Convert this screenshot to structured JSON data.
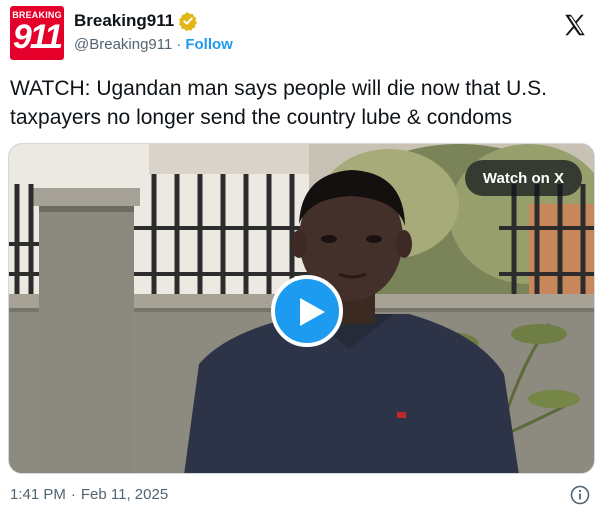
{
  "author": {
    "avatar_text_top": "BREAKING",
    "avatar_text_number": "911",
    "display_name": "Breaking911",
    "handle": "@Breaking911",
    "separator": "·",
    "follow_label": "Follow",
    "verified_icon": "verified-badge-icon",
    "brand_color": "#e4002b"
  },
  "platform_icon": "x-logo-icon",
  "tweet": {
    "line1": "WATCH: Ugandan man says people will die now that U.S.",
    "line2": "taxpayers no longer send the country lube & condoms"
  },
  "media": {
    "watch_label": "Watch on X",
    "play_icon": "play-icon",
    "accent_color": "#1d9bf0"
  },
  "footer": {
    "time": "1:41 PM",
    "separator": "·",
    "date": "Feb 11, 2025",
    "info_icon": "info-icon"
  }
}
